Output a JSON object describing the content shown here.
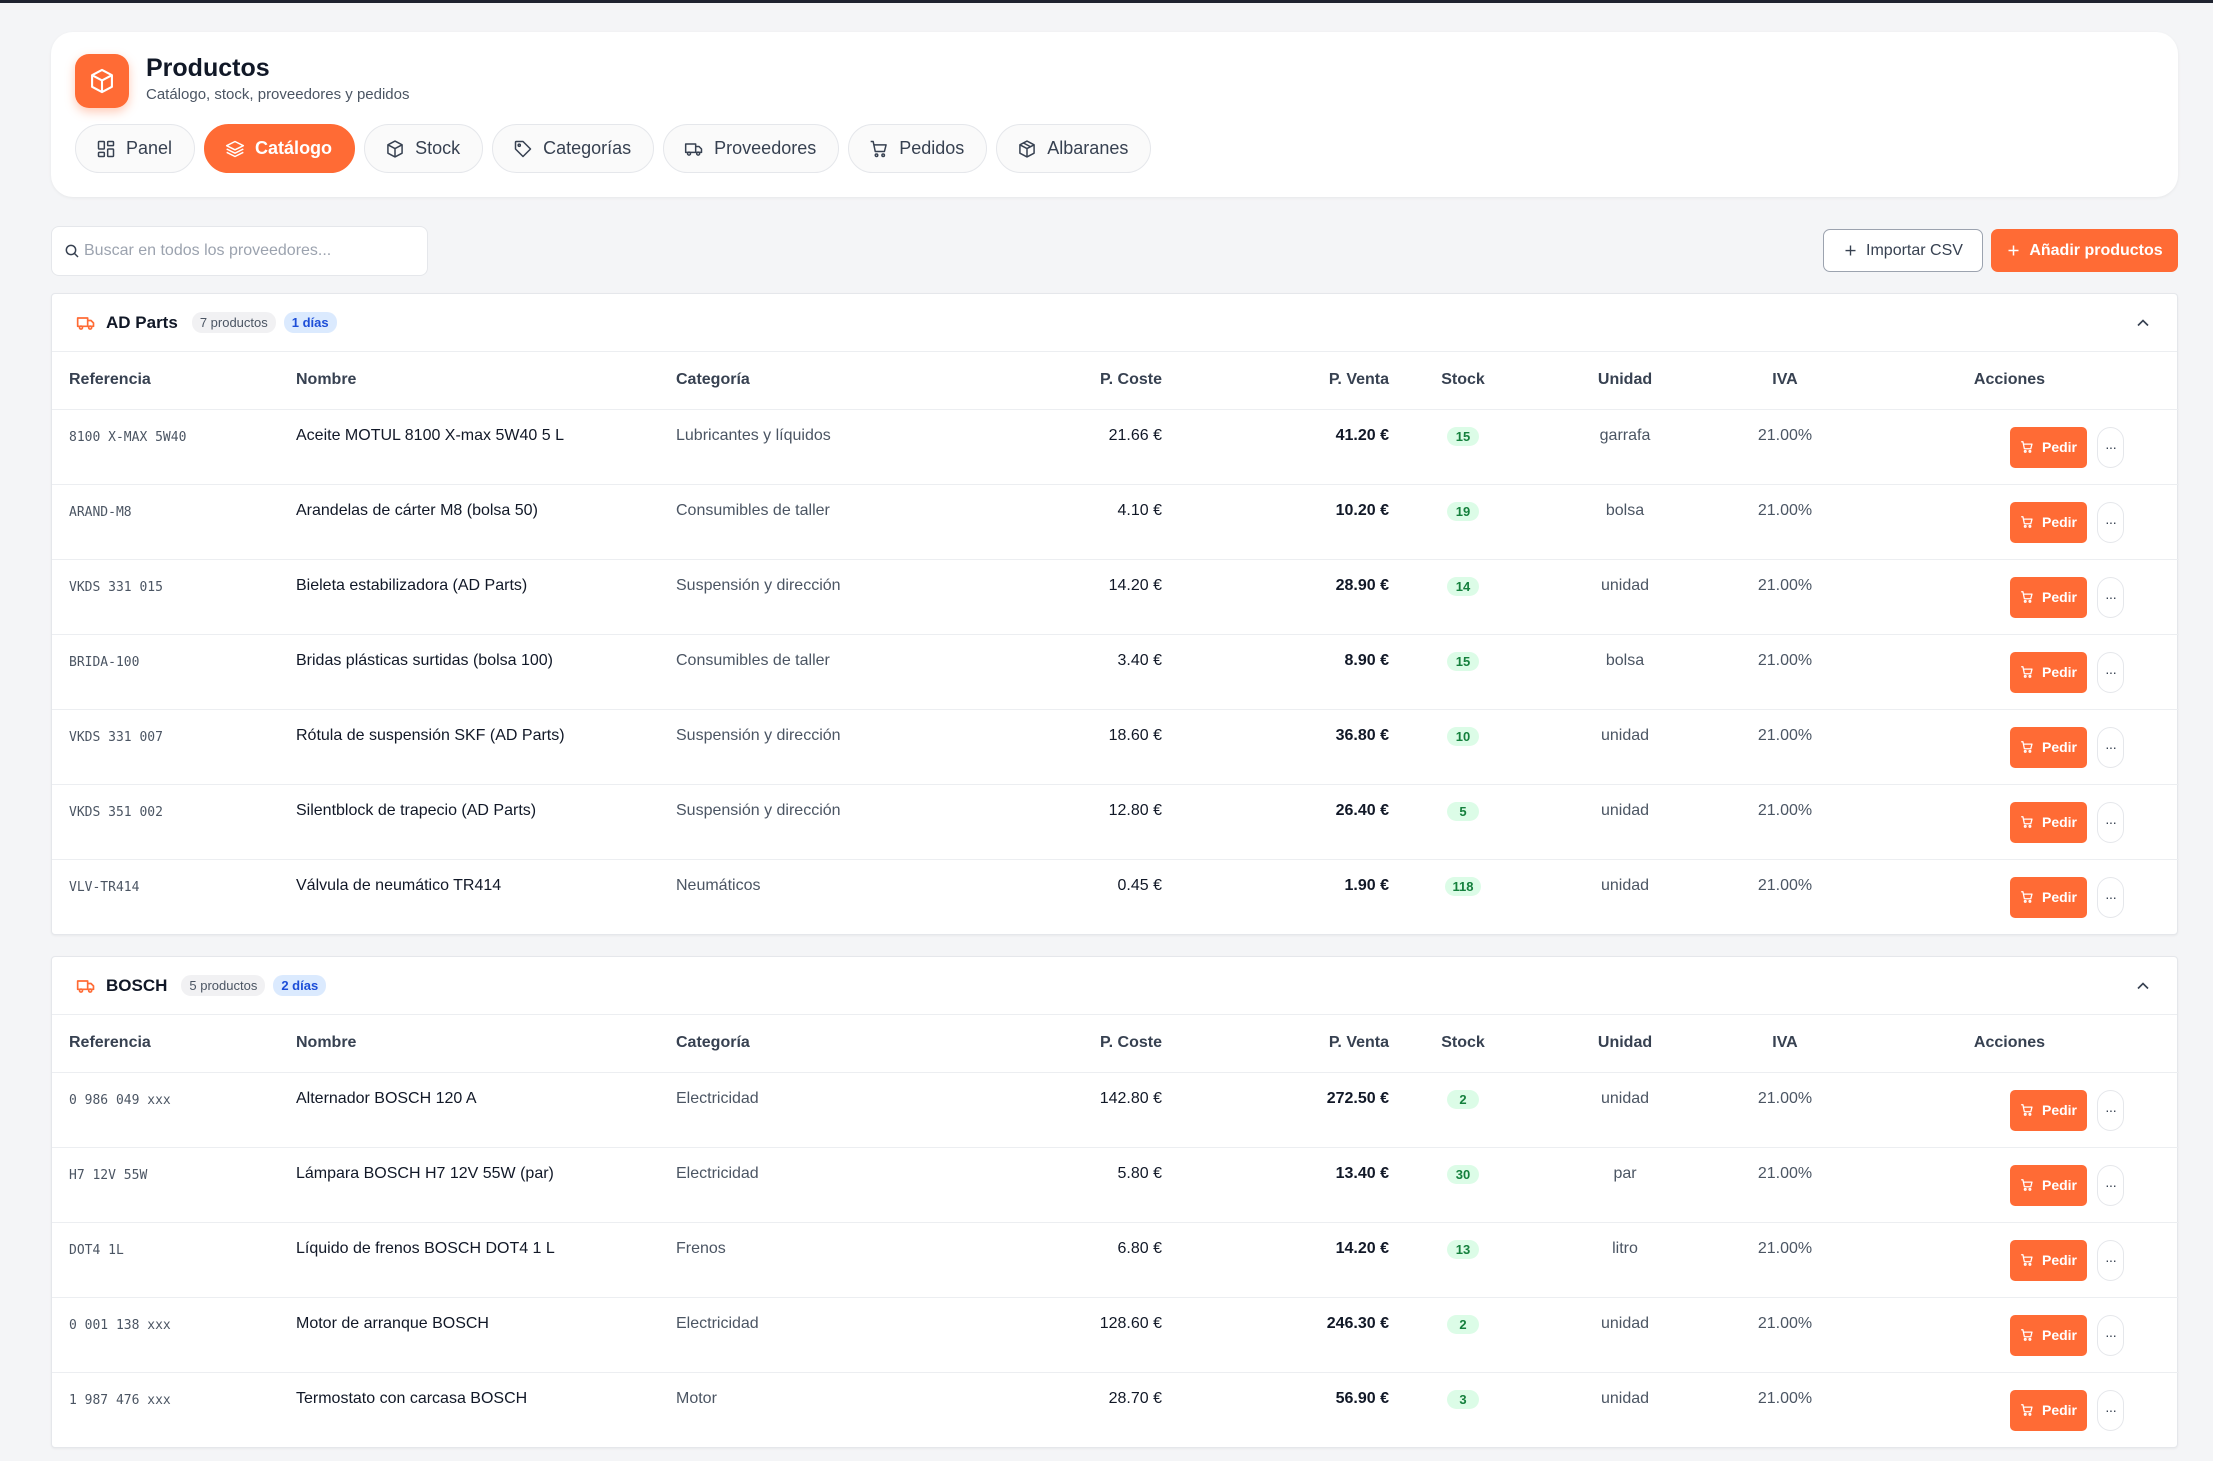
{
  "app": {
    "title": "Productos",
    "subtitle": "Catálogo, stock, proveedores y pedidos",
    "accent": "#ff6b35"
  },
  "tabs": [
    {
      "label": "Panel",
      "icon": "dashboard-icon"
    },
    {
      "label": "Catálogo",
      "icon": "layers-icon",
      "active": true
    },
    {
      "label": "Stock",
      "icon": "box-icon"
    },
    {
      "label": "Categorías",
      "icon": "tag-icon"
    },
    {
      "label": "Proveedores",
      "icon": "truck-icon"
    },
    {
      "label": "Pedidos",
      "icon": "cart-icon"
    },
    {
      "label": "Albaranes",
      "icon": "package-icon"
    }
  ],
  "toolbar": {
    "search_placeholder": "Buscar en todos los proveedores...",
    "import_label": "Importar CSV",
    "add_label": "Añadir productos"
  },
  "columns": [
    "Referencia",
    "Nombre",
    "Categoría",
    "P. Coste",
    "P. Venta",
    "Stock",
    "Unidad",
    "IVA",
    "Acciones"
  ],
  "row_action": {
    "order_label": "Pedir",
    "more_label": "···"
  },
  "suppliers": [
    {
      "name": "AD Parts",
      "count_label": "7 productos",
      "days_label": "1 días",
      "products": [
        {
          "ref": "8100 X-MAX 5W40",
          "name": "Aceite MOTUL 8100 X-max 5W40 5 L",
          "category": "Lubricantes y líquidos",
          "cost": "21.66 €",
          "price": "41.20 €",
          "stock": "15",
          "unit": "garrafa",
          "vat": "21.00%"
        },
        {
          "ref": "ARAND-M8",
          "name": "Arandelas de cárter M8 (bolsa 50)",
          "category": "Consumibles de taller",
          "cost": "4.10 €",
          "price": "10.20 €",
          "stock": "19",
          "unit": "bolsa",
          "vat": "21.00%"
        },
        {
          "ref": "VKDS 331 015",
          "name": "Bieleta estabilizadora (AD Parts)",
          "category": "Suspensión y dirección",
          "cost": "14.20 €",
          "price": "28.90 €",
          "stock": "14",
          "unit": "unidad",
          "vat": "21.00%"
        },
        {
          "ref": "BRIDA-100",
          "name": "Bridas plásticas surtidas (bolsa 100)",
          "category": "Consumibles de taller",
          "cost": "3.40 €",
          "price": "8.90 €",
          "stock": "15",
          "unit": "bolsa",
          "vat": "21.00%"
        },
        {
          "ref": "VKDS 331 007",
          "name": "Rótula de suspensión SKF (AD Parts)",
          "category": "Suspensión y dirección",
          "cost": "18.60 €",
          "price": "36.80 €",
          "stock": "10",
          "unit": "unidad",
          "vat": "21.00%"
        },
        {
          "ref": "VKDS 351 002",
          "name": "Silentblock de trapecio (AD Parts)",
          "category": "Suspensión y dirección",
          "cost": "12.80 €",
          "price": "26.40 €",
          "stock": "5",
          "unit": "unidad",
          "vat": "21.00%"
        },
        {
          "ref": "VLV-TR414",
          "name": "Válvula de neumático TR414",
          "category": "Neumáticos",
          "cost": "0.45 €",
          "price": "1.90 €",
          "stock": "118",
          "unit": "unidad",
          "vat": "21.00%"
        }
      ]
    },
    {
      "name": "BOSCH",
      "count_label": "5 productos",
      "days_label": "2 días",
      "products": [
        {
          "ref": "0 986 049 xxx",
          "name": "Alternador BOSCH 120 A",
          "category": "Electricidad",
          "cost": "142.80 €",
          "price": "272.50 €",
          "stock": "2",
          "unit": "unidad",
          "vat": "21.00%"
        },
        {
          "ref": "H7 12V 55W",
          "name": "Lámpara BOSCH H7 12V 55W (par)",
          "category": "Electricidad",
          "cost": "5.80 €",
          "price": "13.40 €",
          "stock": "30",
          "unit": "par",
          "vat": "21.00%"
        },
        {
          "ref": "DOT4 1L",
          "name": "Líquido de frenos BOSCH DOT4 1 L",
          "category": "Frenos",
          "cost": "6.80 €",
          "price": "14.20 €",
          "stock": "13",
          "unit": "litro",
          "vat": "21.00%"
        },
        {
          "ref": "0 001 138 xxx",
          "name": "Motor de arranque BOSCH",
          "category": "Electricidad",
          "cost": "128.60 €",
          "price": "246.30 €",
          "stock": "2",
          "unit": "unidad",
          "vat": "21.00%"
        },
        {
          "ref": "1 987 476 xxx",
          "name": "Termostato con carcasa BOSCH",
          "category": "Motor",
          "cost": "28.70 €",
          "price": "56.90 €",
          "stock": "3",
          "unit": "unidad",
          "vat": "21.00%"
        }
      ]
    }
  ]
}
